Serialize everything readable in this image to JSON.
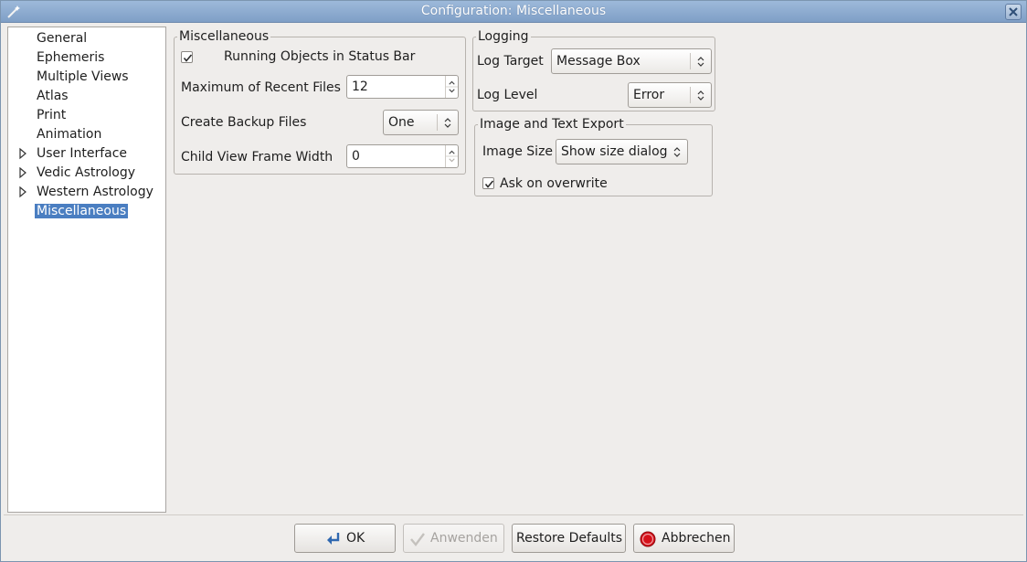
{
  "window": {
    "title": "Configuration: Miscellaneous"
  },
  "nav": {
    "items": [
      {
        "label": "General",
        "expandable": false
      },
      {
        "label": "Ephemeris",
        "expandable": false
      },
      {
        "label": "Multiple Views",
        "expandable": false
      },
      {
        "label": "Atlas",
        "expandable": false
      },
      {
        "label": "Print",
        "expandable": false
      },
      {
        "label": "Animation",
        "expandable": false
      },
      {
        "label": "User Interface",
        "expandable": true
      },
      {
        "label": "Vedic Astrology",
        "expandable": true
      },
      {
        "label": "Western Astrology",
        "expandable": true
      },
      {
        "label": "Miscellaneous",
        "expandable": false,
        "selected": true
      }
    ]
  },
  "misc": {
    "title": "Miscellaneous",
    "running_objects": {
      "label": "Running Objects in Status Bar",
      "checked": true
    },
    "recent_files": {
      "label": "Maximum of Recent Files",
      "value": "12"
    },
    "backup_files": {
      "label": "Create Backup Files",
      "value": "One"
    },
    "frame_width": {
      "label": "Child View Frame Width",
      "value": "0"
    }
  },
  "logging": {
    "title": "Logging",
    "log_target": {
      "label": "Log Target",
      "value": "Message Box"
    },
    "log_level": {
      "label": "Log Level",
      "value": "Error"
    }
  },
  "export": {
    "title": "Image and Text Export",
    "image_size": {
      "label": "Image Size",
      "value": "Show size dialog"
    },
    "ask_overwrite": {
      "label": "Ask on overwrite",
      "checked": true
    }
  },
  "buttons": {
    "ok": "OK",
    "apply": "Anwenden",
    "restore": "Restore Defaults",
    "cancel": "Abbrechen"
  },
  "colors": {
    "selection": "#4a7ec1",
    "titlebar": "#8aa9cf",
    "cancel_icon": "#d6111a"
  }
}
